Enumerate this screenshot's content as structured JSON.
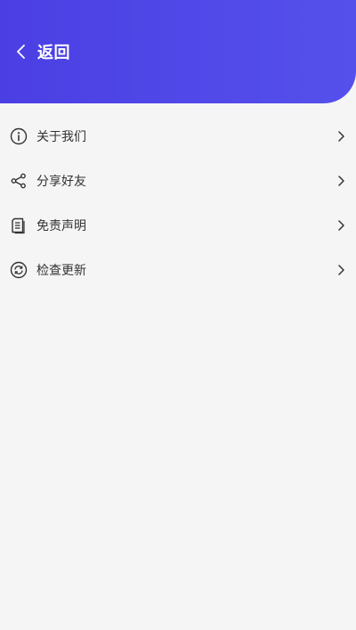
{
  "theme": {
    "header_gradient_start": "#4b3fe3",
    "header_gradient_end": "#5550ec",
    "background": "#f5f5f5",
    "text": "#333333",
    "icon": "#333333"
  },
  "header": {
    "back_icon": "chevron-left-icon",
    "title": "返回"
  },
  "menu": {
    "items": [
      {
        "label": "关于我们",
        "icon": "info-icon"
      },
      {
        "label": "分享好友",
        "icon": "share-icon"
      },
      {
        "label": "免责声明",
        "icon": "document-icon"
      },
      {
        "label": "检查更新",
        "icon": "refresh-icon"
      }
    ]
  }
}
